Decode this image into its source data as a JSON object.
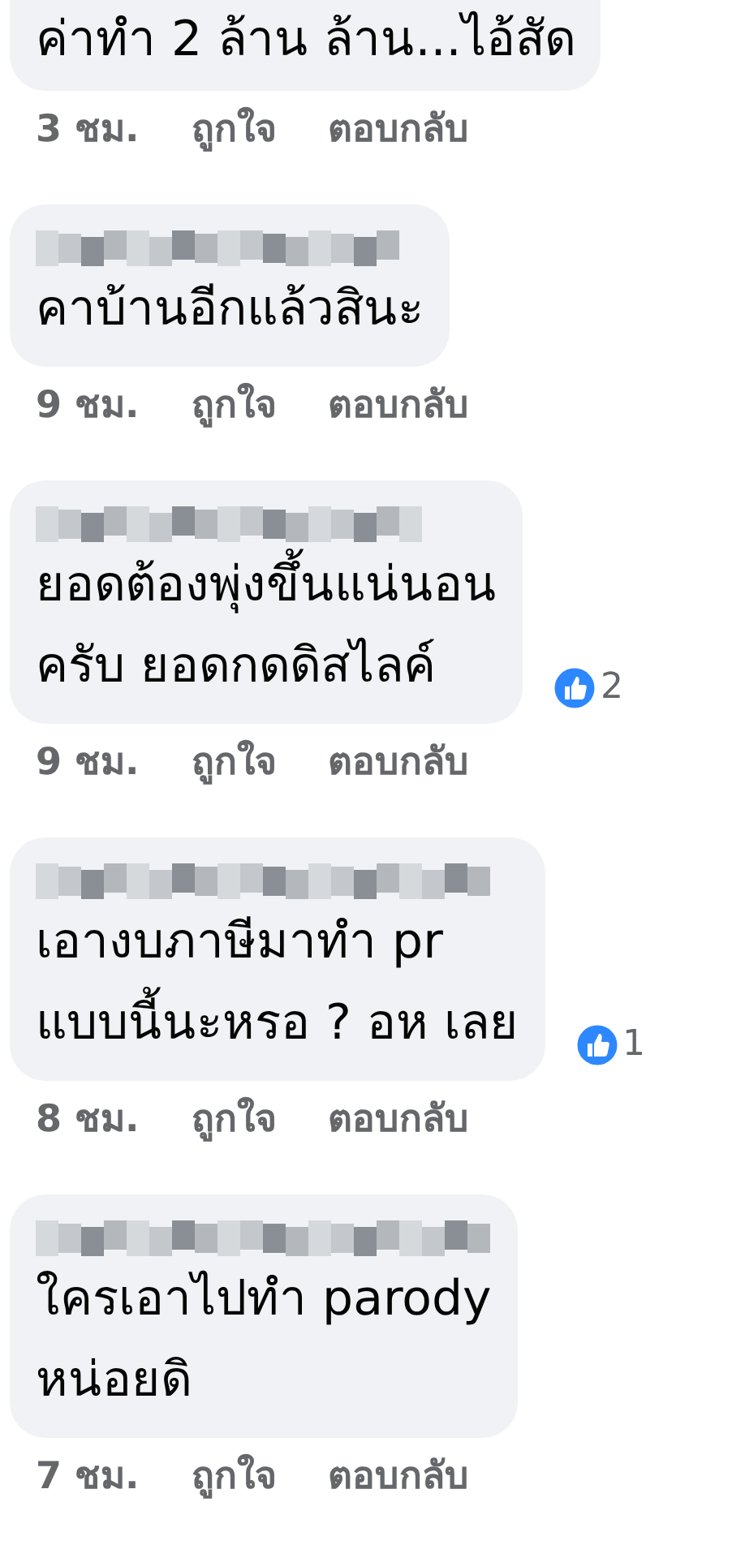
{
  "comments": [
    {
      "kind": "cut",
      "lines": [
        "ค่าทำ 2 ล้าน ล้าน...ไอ้สัด"
      ],
      "time": "3 ชม.",
      "like": "ถูกใจ",
      "reply": "ตอบกลับ"
    },
    {
      "kind": "full",
      "lines": [
        "คาบ้านอีกแล้วสินะ"
      ],
      "time": "9 ชม.",
      "like": "ถูกใจ",
      "reply": "ตอบกลับ"
    },
    {
      "kind": "full",
      "lines": [
        "ยอดต้องพุ่งขึ้นแน่นอน",
        "ครับ ยอดกดดิสไลค์"
      ],
      "reaction_count": "2",
      "time": "9 ชม.",
      "like": "ถูกใจ",
      "reply": "ตอบกลับ"
    },
    {
      "kind": "full",
      "lines": [
        "เอางบภาษีมาทำ pr",
        "แบบนี้นะหรอ ? อห เลย"
      ],
      "reaction_count": "1",
      "time": "8 ชม.",
      "like": "ถูกใจ",
      "reply": "ตอบกลับ"
    },
    {
      "kind": "full",
      "lines": [
        "ใครเอาไปทำ parody",
        "หน่อยดิ"
      ],
      "time": "7 ชม.",
      "like": "ถูกใจ",
      "reply": "ตอบกลับ"
    }
  ]
}
